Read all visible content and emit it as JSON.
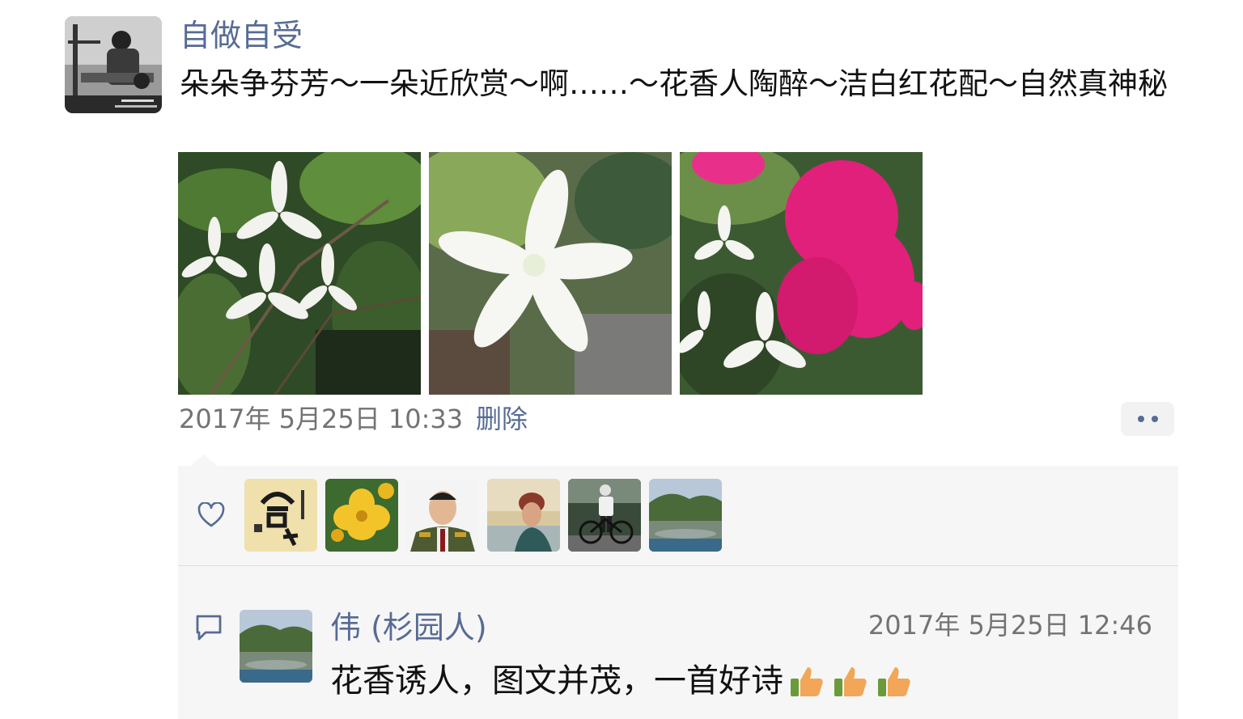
{
  "post": {
    "author": "自做自受",
    "text": "朵朵争芬芳～一朵近欣赏～啊……～花香人陶醉～洁白红花配～自然真神秘",
    "timestamp": "2017年 5月25日 10:33",
    "delete_label": "删除"
  },
  "likes": {
    "avatars": [
      "calligraphy-avatar",
      "yellow-flower-avatar",
      "officer-portrait-avatar",
      "woman-sunset-avatar",
      "cyclist-avatar",
      "river-landscape-avatar"
    ]
  },
  "comment": {
    "author": "伟 (杉园人)",
    "timestamp": "2017年 5月25日 12:46",
    "text": "花香诱人，图文并茂，一首好诗",
    "emoji": [
      "thumbs-up",
      "thumbs-up",
      "thumbs-up"
    ]
  },
  "colors": {
    "link": "#576b95",
    "meta": "#737373",
    "panel": "#f6f6f6"
  }
}
